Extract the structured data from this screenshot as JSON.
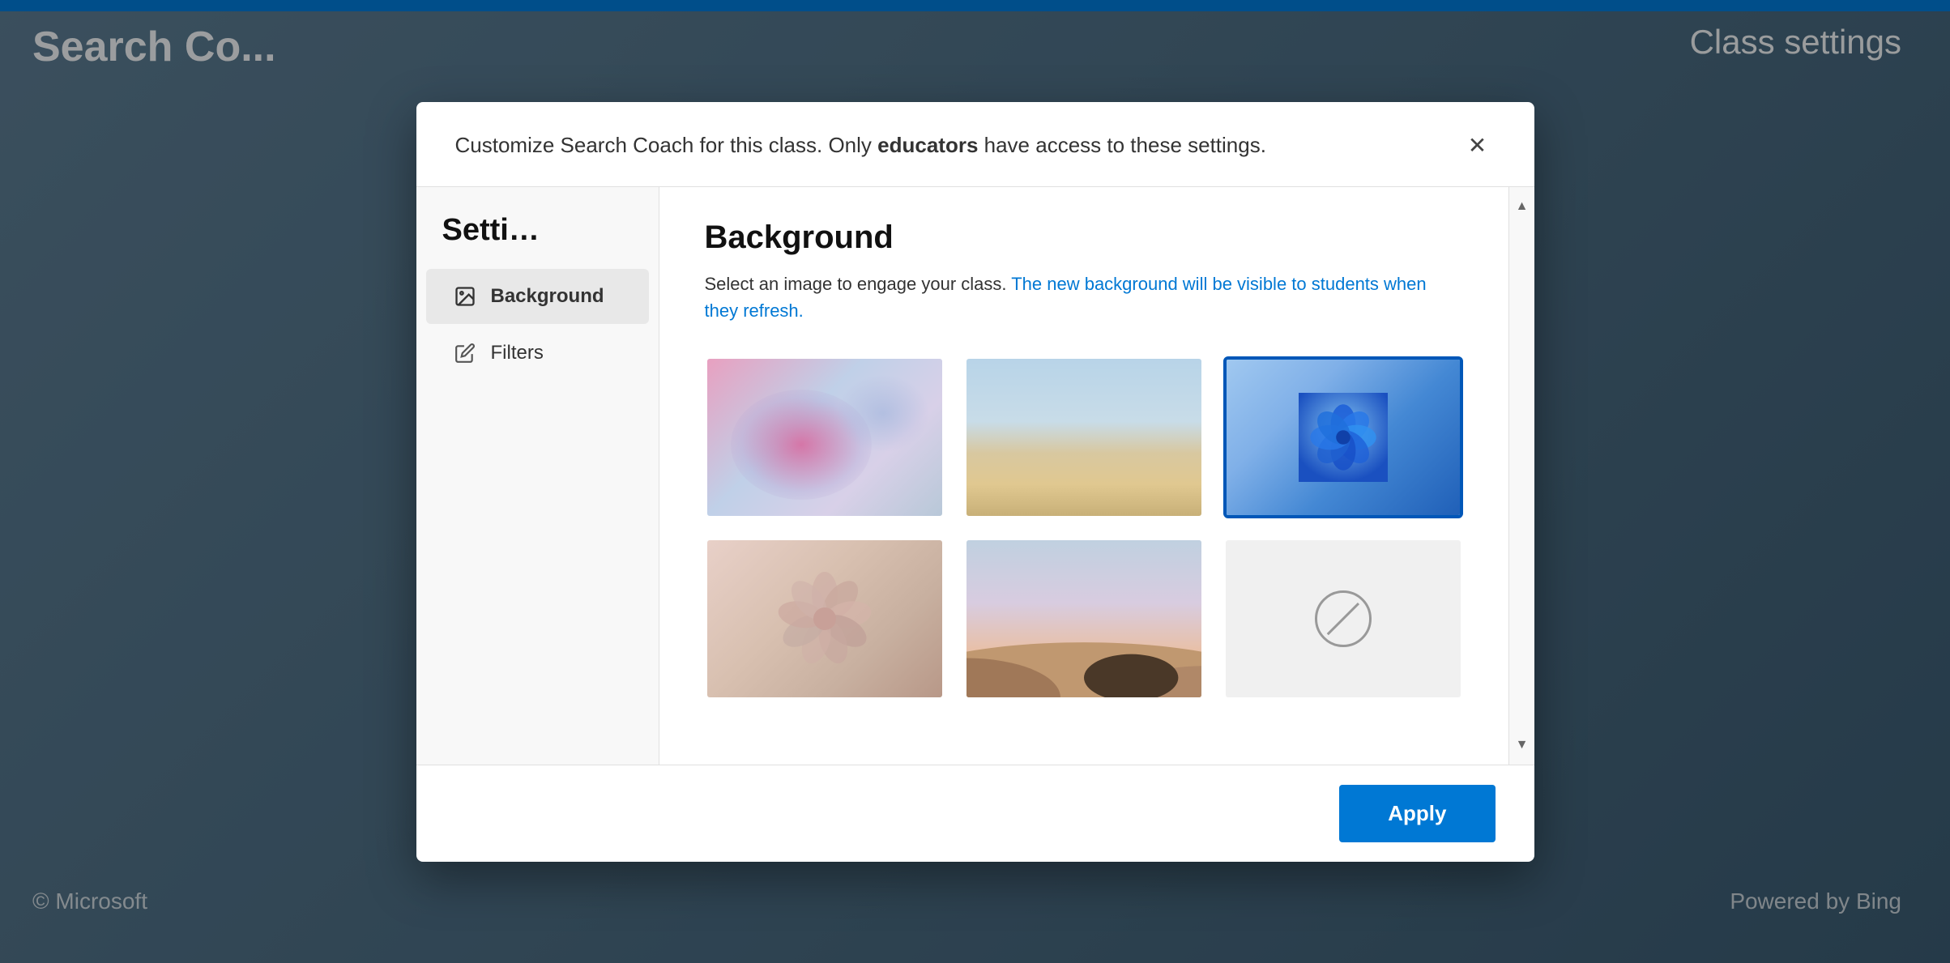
{
  "page": {
    "background_title_left": "Search Co...",
    "background_title_right": "Class settings",
    "microsoft_footer": "© Microsoft",
    "powered_footer": "Powered by Bing"
  },
  "dialog": {
    "header_text": "Customize Search Coach for this class. Only ",
    "header_text_bold": "educators",
    "header_text_end": " have access to these settings.",
    "close_label": "×",
    "sidebar": {
      "title": "Setti...",
      "items": [
        {
          "id": "background",
          "label": "Background",
          "icon": "image-icon",
          "active": true
        },
        {
          "id": "filters",
          "label": "Filters",
          "icon": "pencil-icon",
          "active": false
        }
      ]
    },
    "content": {
      "title": "Background",
      "description_start": "Select an image to engage your class. ",
      "description_highlight": "The new background will be visible to students when they refresh.",
      "images": [
        {
          "id": "img1",
          "alt": "Abstract pink and blue bubbles",
          "selected": false
        },
        {
          "id": "img2",
          "alt": "Desert sand dunes daytime",
          "selected": false
        },
        {
          "id": "img3",
          "alt": "Windows 11 bloom logo",
          "selected": true
        },
        {
          "id": "img4",
          "alt": "Pink flower close-up",
          "selected": false
        },
        {
          "id": "img5",
          "alt": "Desert sunset landscape",
          "selected": false
        },
        {
          "id": "img6",
          "alt": "No background",
          "selected": false
        }
      ]
    },
    "footer": {
      "apply_label": "Apply"
    }
  }
}
